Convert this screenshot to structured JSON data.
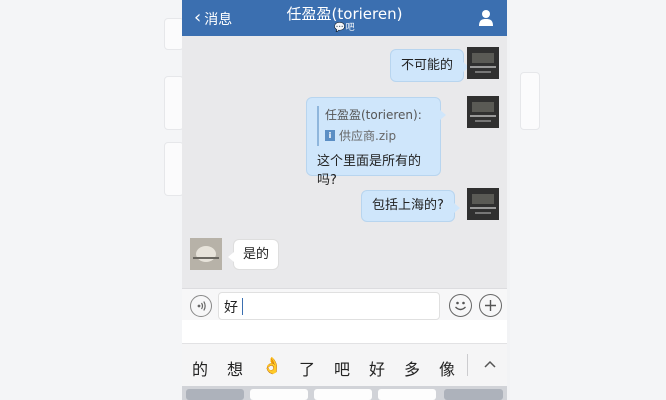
{
  "navbar": {
    "back_label": "消息",
    "title": "任盈盈(torieren)",
    "subtitle": "吧"
  },
  "messages": [
    {
      "side": "right",
      "text": "不可能的"
    },
    {
      "side": "right",
      "quote_author": "任盈盈(torieren):",
      "quote_file": "供应商.zip",
      "text": "这个里面是所有的吗?"
    },
    {
      "side": "right",
      "text": "包括上海的?"
    },
    {
      "side": "left",
      "text": "是的"
    }
  ],
  "input": {
    "value": "好"
  },
  "candidates": [
    "的",
    "想",
    "👌",
    "了",
    "吧",
    "好",
    "多",
    "像"
  ],
  "colors": {
    "navbar_bg": "#3b6fb0",
    "bubble_sent": "#cfe6fb",
    "bubble_received": "#ffffff"
  },
  "icons": {
    "back": "chevron-left-icon",
    "profile": "person-icon",
    "voice": "voice-icon",
    "emoji": "emoji-icon",
    "plus": "plus-icon",
    "collapse": "chevron-up-icon",
    "file": "info-icon"
  }
}
